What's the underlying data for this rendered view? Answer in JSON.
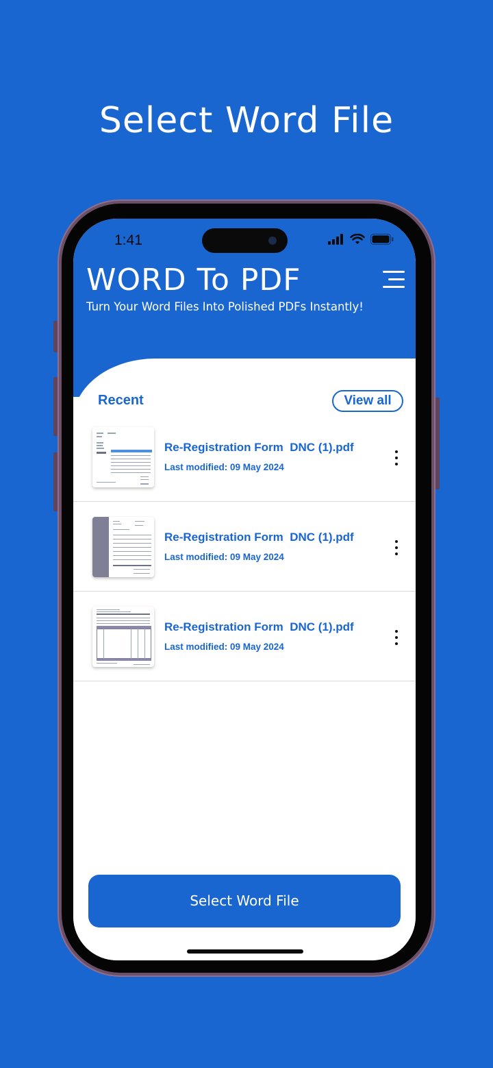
{
  "promo": {
    "headline": "Select Word File"
  },
  "status_bar": {
    "time": "1:41"
  },
  "app": {
    "title": "WORD To PDF",
    "subtitle": "Turn Your Word Files Into Polished PDFs Instantly!",
    "menu_icon": "hamburger-menu-icon"
  },
  "recent": {
    "label": "Recent",
    "view_all": "View all",
    "files": [
      {
        "name": "Re-Registration Form  DNC (1).pdf",
        "modified": "Last modified: 09 May 2024",
        "thumb": "invoice-thumbnail"
      },
      {
        "name": "Re-Registration Form  DNC (1).pdf",
        "modified": "Last modified: 09 May 2024",
        "thumb": "sidebar-document-thumbnail"
      },
      {
        "name": "Re-Registration Form  DNC (1).pdf",
        "modified": "Last modified: 09 May 2024",
        "thumb": "form-table-thumbnail"
      }
    ]
  },
  "actions": {
    "select_word_file": "Select Word File"
  },
  "colors": {
    "primary": "#1a66d1",
    "background": "#1a66d1",
    "text_on_primary": "#ffffff"
  }
}
